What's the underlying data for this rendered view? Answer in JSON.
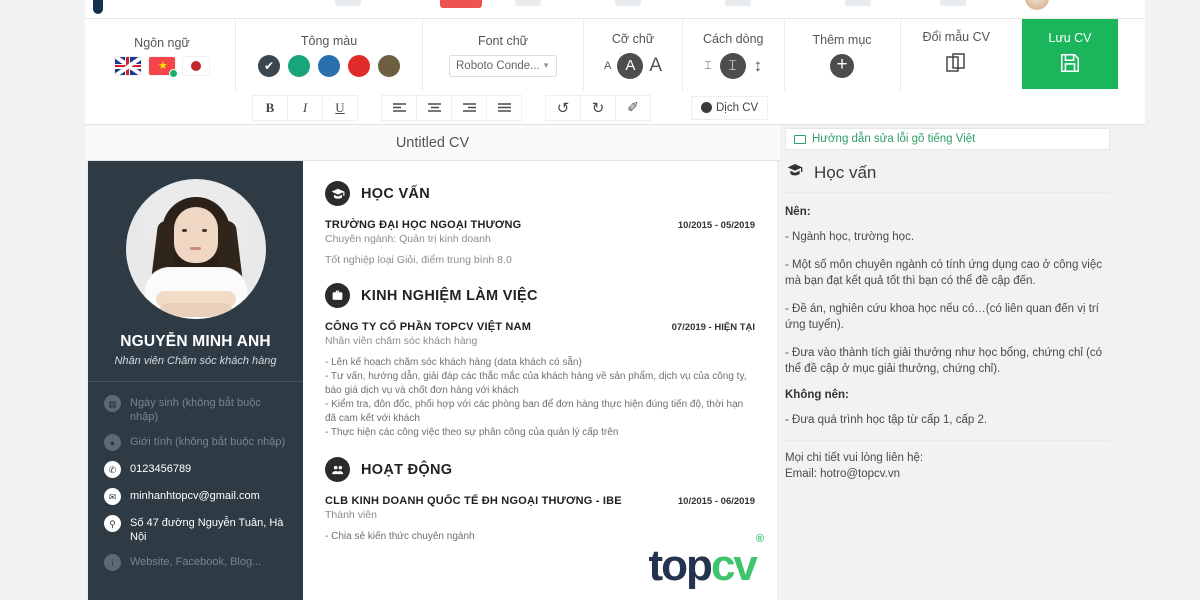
{
  "toolbar": {
    "groups": {
      "language": {
        "label": "Ngôn ngữ",
        "flags": [
          "flag-uk",
          "flag-vietnam",
          "flag-japan"
        ],
        "selected": "flag-vietnam"
      },
      "tone": {
        "label": "Tông màu",
        "colors": [
          "#3a4750",
          "#18a57a",
          "#2b6fad",
          "#e02b2b",
          "#6e5f43"
        ],
        "selected_index": 0
      },
      "font": {
        "label": "Font chữ",
        "value": "Roboto Conde..."
      },
      "size": {
        "label": "Cỡ chữ",
        "small": "A",
        "medium": "A",
        "large": "A"
      },
      "linespacing": {
        "label": "Cách dòng",
        "small": "⌶",
        "medium": "⌶",
        "large": "↕"
      },
      "addsection": {
        "label": "Thêm mục",
        "icon": "plus-circle-icon"
      },
      "template": {
        "label": "Đổi mẫu CV",
        "icon": "copy-pages-icon"
      },
      "save": {
        "label": "Lưu CV",
        "icon": "floppy-disk-icon",
        "color": "#1bb55c"
      }
    },
    "format": {
      "bold": "B",
      "italic": "I",
      "underline": "U",
      "align_left": "≡",
      "align_center": "≡",
      "align_right": "≡",
      "align_justify": "≡",
      "undo": "↺",
      "redo": "↻",
      "clear": "✐",
      "translate": "Dịch CV"
    }
  },
  "cv": {
    "title": "Untitled CV",
    "profile": {
      "name": "NGUYỄN MINH ANH",
      "role": "Nhân viên Chăm sóc khách hàng"
    },
    "contacts": [
      {
        "icon": "calendar-icon",
        "text": "Ngày sinh (không bắt buộc nhập)",
        "state": "placeholder"
      },
      {
        "icon": "user-icon",
        "text": "Giới tính (không bắt buộc nhập)",
        "state": "placeholder"
      },
      {
        "icon": "phone-icon",
        "text": "0123456789",
        "state": "filled"
      },
      {
        "icon": "envelope-icon",
        "text": "minhanhtopcv@gmail.com",
        "state": "filled"
      },
      {
        "icon": "location-pin-icon",
        "text": "Số 47 đường Nguyễn Tuân, Hà Nội",
        "state": "filled"
      },
      {
        "icon": "info-icon",
        "text": "Website, Facebook, Blog...",
        "state": "placeholder"
      }
    ],
    "sections": [
      {
        "icon": "graduation-cap-icon",
        "title": "HỌC VẤN",
        "org": "TRƯỜNG ĐẠI HỌC NGOẠI THƯƠNG",
        "date": "10/2015 - 05/2019",
        "role": "Chuyên ngành: Quản trị kinh doanh",
        "note": "Tốt nghiệp loại Giỏi, điểm trung bình 8.0",
        "bullets": ""
      },
      {
        "icon": "briefcase-icon",
        "title": "KINH NGHIỆM LÀM VIỆC",
        "org": "CÔNG TY CỔ PHẦN TOPCV VIỆT NAM",
        "date": "07/2019 - HIỆN TẠI",
        "role": "Nhân viên chăm sóc khách hàng",
        "note": "",
        "bullets": "- Lên kế hoạch chăm sóc khách hàng (data khách có sẵn)\n- Tư vấn, hướng dẫn, giải đáp các thắc mắc của khách hàng về sản phẩm, dịch vụ của công ty, báo giá dịch vụ và chốt đơn hàng với khách\n- Kiểm tra, đôn đốc, phối hợp với các phòng ban để đơn hàng thực hiện đúng tiến độ, thời hạn đã cam kết với khách\n- Thực hiện các công việc theo sự phân công của quản lý cấp trên"
      },
      {
        "icon": "people-group-icon",
        "title": "HOẠT ĐỘNG",
        "org": "CLB KINH DOANH QUỐC TẾ ĐH NGOẠI THƯƠNG - IBE",
        "date": "10/2015 - 06/2019",
        "role": "Thành viên",
        "note": "",
        "bullets": "- Chia sẻ kiến thức chuyên ngành"
      }
    ],
    "watermark": {
      "part1": "top",
      "part2": "cv",
      "mark": "®"
    }
  },
  "tips": {
    "guide_link": "Hướng dẫn sửa lỗi gõ tiếng Việt",
    "heading": "Học vấn",
    "do_label": "Nên:",
    "do_items": [
      "- Ngành học, trường học.",
      "- Một số môn chuyên ngành có tính ứng dụng cao ở công việc mà bạn đạt kết quả tốt thì bạn có thể đề cập đến.",
      "- Đề án, nghiên cứu khoa học nếu có…(có liên quan đến vị trí ứng tuyển).",
      "- Đưa vào thành tích giải thưởng như học bổng, chứng chỉ (có thể đề cập ở mục giải thưởng, chứng chỉ)."
    ],
    "dont_label": "Không nên:",
    "dont_items": [
      "- Đưa quá trình học tập từ cấp 1, cấp 2."
    ],
    "contact_line1": "Mọi chi tiết vui lòng liên hệ:",
    "contact_line2": "Email: hotro@topcv.vn"
  }
}
